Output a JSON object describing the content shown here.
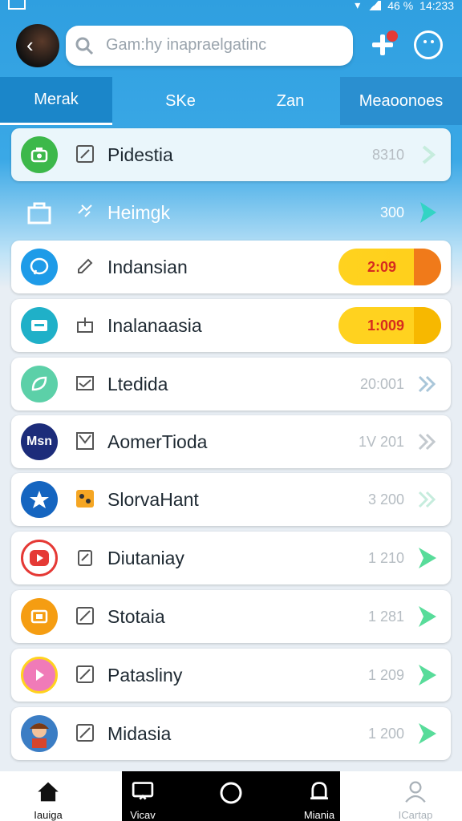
{
  "status_bar": {
    "battery": "46 %",
    "time": "14:233"
  },
  "search": {
    "placeholder": "Gam:hy inapraelgatinc"
  },
  "tabs": [
    {
      "label": "Merak"
    },
    {
      "label": "SKe"
    },
    {
      "label": "Zan"
    },
    {
      "label": "Meaoonoes"
    }
  ],
  "rows": [
    {
      "name": "Pidestia",
      "value": "8310",
      "icon": "camera-icon",
      "color": "#3cb84a"
    },
    {
      "name": "Heimgk",
      "value": "300",
      "icon": "bag-icon",
      "color": "#ffffff"
    },
    {
      "name": "Indansian",
      "value": "2:09",
      "icon": "messenger-icon",
      "color": "#1e9be8"
    },
    {
      "name": "Inalanaasia",
      "value": "1:009",
      "icon": "wallet-icon",
      "color": "#1fb0c8"
    },
    {
      "name": "Ltedida",
      "value": "20:001",
      "icon": "leaf-icon",
      "color": "#5cd0a8"
    },
    {
      "name": "AomerTioda",
      "value": "1V 201",
      "icon": "msn-icon",
      "icon_text": "Msn",
      "color": "#1c2c7a"
    },
    {
      "name": "SlorvaHant",
      "value": "3 200",
      "icon": "star-icon",
      "color": "#1565c0"
    },
    {
      "name": "Diutaniay",
      "value": "1 210",
      "icon": "play-icon",
      "color": "#e53935"
    },
    {
      "name": "Stotaia",
      "value": "1 281",
      "icon": "cast-icon",
      "color": "#f59d12"
    },
    {
      "name": "Patasliny",
      "value": "1 209",
      "icon": "arrow-icon",
      "color": "#f07bb8"
    },
    {
      "name": "Midasia",
      "value": "1 200",
      "icon": "character-icon",
      "color": "#3b7dc4"
    }
  ],
  "bottom_nav": [
    {
      "label": "Iauiga",
      "icon": "home-icon"
    },
    {
      "label": "Vicav",
      "icon": "tv-icon"
    },
    {
      "label": "",
      "icon": "circle-icon"
    },
    {
      "label": "Miania",
      "icon": "bell-icon"
    },
    {
      "label": "ICartap",
      "icon": "person-icon"
    }
  ]
}
